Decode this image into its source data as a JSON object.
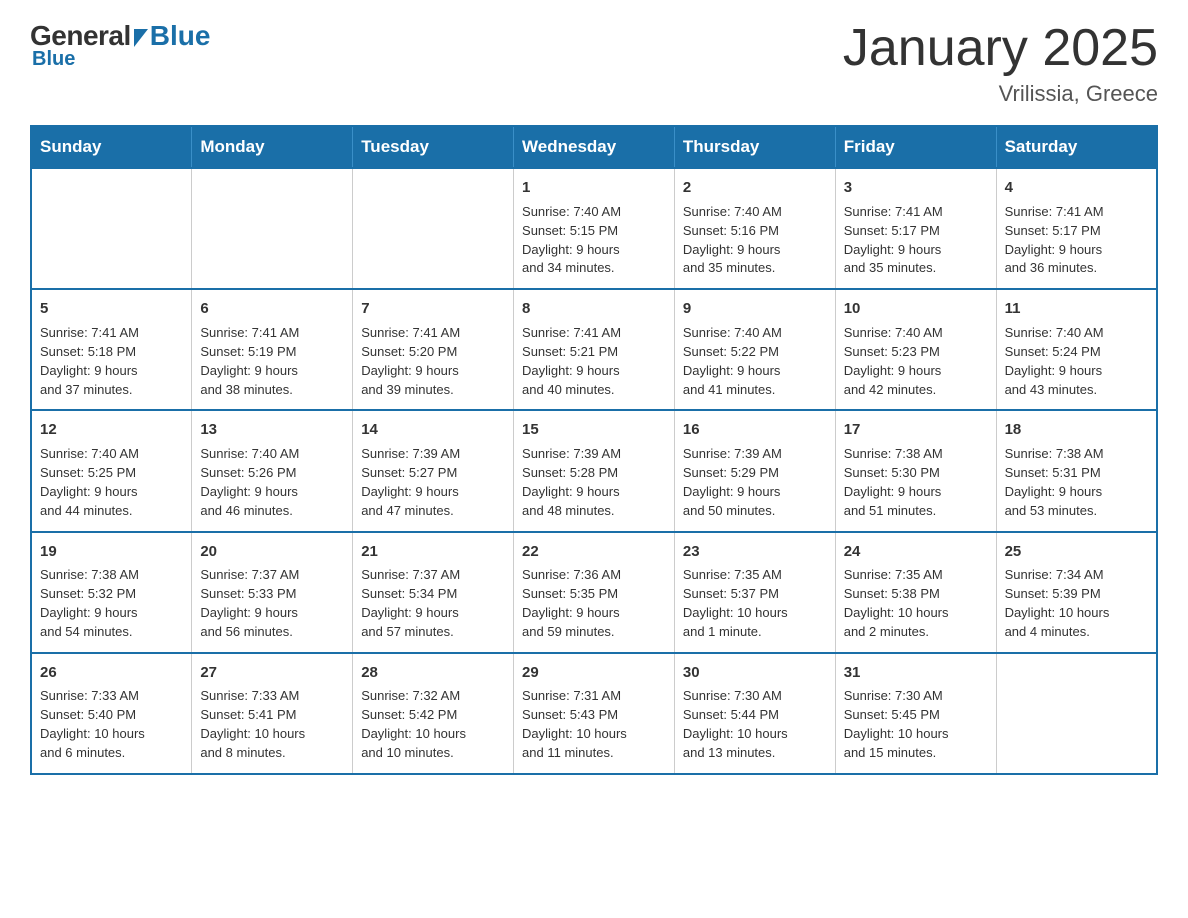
{
  "logo": {
    "general": "General",
    "blue": "Blue"
  },
  "header": {
    "title": "January 2025",
    "location": "Vrilissia, Greece"
  },
  "weekdays": [
    "Sunday",
    "Monday",
    "Tuesday",
    "Wednesday",
    "Thursday",
    "Friday",
    "Saturday"
  ],
  "weeks": [
    [
      {
        "day": "",
        "info": ""
      },
      {
        "day": "",
        "info": ""
      },
      {
        "day": "",
        "info": ""
      },
      {
        "day": "1",
        "info": "Sunrise: 7:40 AM\nSunset: 5:15 PM\nDaylight: 9 hours\nand 34 minutes."
      },
      {
        "day": "2",
        "info": "Sunrise: 7:40 AM\nSunset: 5:16 PM\nDaylight: 9 hours\nand 35 minutes."
      },
      {
        "day": "3",
        "info": "Sunrise: 7:41 AM\nSunset: 5:17 PM\nDaylight: 9 hours\nand 35 minutes."
      },
      {
        "day": "4",
        "info": "Sunrise: 7:41 AM\nSunset: 5:17 PM\nDaylight: 9 hours\nand 36 minutes."
      }
    ],
    [
      {
        "day": "5",
        "info": "Sunrise: 7:41 AM\nSunset: 5:18 PM\nDaylight: 9 hours\nand 37 minutes."
      },
      {
        "day": "6",
        "info": "Sunrise: 7:41 AM\nSunset: 5:19 PM\nDaylight: 9 hours\nand 38 minutes."
      },
      {
        "day": "7",
        "info": "Sunrise: 7:41 AM\nSunset: 5:20 PM\nDaylight: 9 hours\nand 39 minutes."
      },
      {
        "day": "8",
        "info": "Sunrise: 7:41 AM\nSunset: 5:21 PM\nDaylight: 9 hours\nand 40 minutes."
      },
      {
        "day": "9",
        "info": "Sunrise: 7:40 AM\nSunset: 5:22 PM\nDaylight: 9 hours\nand 41 minutes."
      },
      {
        "day": "10",
        "info": "Sunrise: 7:40 AM\nSunset: 5:23 PM\nDaylight: 9 hours\nand 42 minutes."
      },
      {
        "day": "11",
        "info": "Sunrise: 7:40 AM\nSunset: 5:24 PM\nDaylight: 9 hours\nand 43 minutes."
      }
    ],
    [
      {
        "day": "12",
        "info": "Sunrise: 7:40 AM\nSunset: 5:25 PM\nDaylight: 9 hours\nand 44 minutes."
      },
      {
        "day": "13",
        "info": "Sunrise: 7:40 AM\nSunset: 5:26 PM\nDaylight: 9 hours\nand 46 minutes."
      },
      {
        "day": "14",
        "info": "Sunrise: 7:39 AM\nSunset: 5:27 PM\nDaylight: 9 hours\nand 47 minutes."
      },
      {
        "day": "15",
        "info": "Sunrise: 7:39 AM\nSunset: 5:28 PM\nDaylight: 9 hours\nand 48 minutes."
      },
      {
        "day": "16",
        "info": "Sunrise: 7:39 AM\nSunset: 5:29 PM\nDaylight: 9 hours\nand 50 minutes."
      },
      {
        "day": "17",
        "info": "Sunrise: 7:38 AM\nSunset: 5:30 PM\nDaylight: 9 hours\nand 51 minutes."
      },
      {
        "day": "18",
        "info": "Sunrise: 7:38 AM\nSunset: 5:31 PM\nDaylight: 9 hours\nand 53 minutes."
      }
    ],
    [
      {
        "day": "19",
        "info": "Sunrise: 7:38 AM\nSunset: 5:32 PM\nDaylight: 9 hours\nand 54 minutes."
      },
      {
        "day": "20",
        "info": "Sunrise: 7:37 AM\nSunset: 5:33 PM\nDaylight: 9 hours\nand 56 minutes."
      },
      {
        "day": "21",
        "info": "Sunrise: 7:37 AM\nSunset: 5:34 PM\nDaylight: 9 hours\nand 57 minutes."
      },
      {
        "day": "22",
        "info": "Sunrise: 7:36 AM\nSunset: 5:35 PM\nDaylight: 9 hours\nand 59 minutes."
      },
      {
        "day": "23",
        "info": "Sunrise: 7:35 AM\nSunset: 5:37 PM\nDaylight: 10 hours\nand 1 minute."
      },
      {
        "day": "24",
        "info": "Sunrise: 7:35 AM\nSunset: 5:38 PM\nDaylight: 10 hours\nand 2 minutes."
      },
      {
        "day": "25",
        "info": "Sunrise: 7:34 AM\nSunset: 5:39 PM\nDaylight: 10 hours\nand 4 minutes."
      }
    ],
    [
      {
        "day": "26",
        "info": "Sunrise: 7:33 AM\nSunset: 5:40 PM\nDaylight: 10 hours\nand 6 minutes."
      },
      {
        "day": "27",
        "info": "Sunrise: 7:33 AM\nSunset: 5:41 PM\nDaylight: 10 hours\nand 8 minutes."
      },
      {
        "day": "28",
        "info": "Sunrise: 7:32 AM\nSunset: 5:42 PM\nDaylight: 10 hours\nand 10 minutes."
      },
      {
        "day": "29",
        "info": "Sunrise: 7:31 AM\nSunset: 5:43 PM\nDaylight: 10 hours\nand 11 minutes."
      },
      {
        "day": "30",
        "info": "Sunrise: 7:30 AM\nSunset: 5:44 PM\nDaylight: 10 hours\nand 13 minutes."
      },
      {
        "day": "31",
        "info": "Sunrise: 7:30 AM\nSunset: 5:45 PM\nDaylight: 10 hours\nand 15 minutes."
      },
      {
        "day": "",
        "info": ""
      }
    ]
  ]
}
